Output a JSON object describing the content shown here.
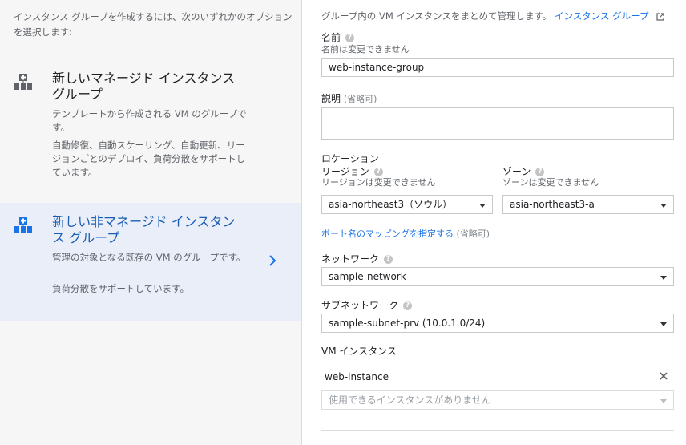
{
  "left": {
    "intro": "インスタンス グループを作成するには、次のいずれかのオプションを選択します:",
    "managed": {
      "title": "新しいマネージド インスタンス グループ",
      "desc1": "テンプレートから作成される VM のグループです。",
      "desc2": "自動修復、自動スケーリング、自動更新、リージョンごとのデプロイ、負荷分散をサポートしています。"
    },
    "unmanaged": {
      "title": "新しい非マネージド インスタンス グループ",
      "desc1": "管理の対象となる既存の VM のグループです。",
      "desc2": "負荷分散をサポートしています。"
    }
  },
  "form": {
    "header_text": "グループ内の VM インスタンスをまとめて管理します。",
    "header_link": "インスタンス グループ",
    "name_label": "名前",
    "name_sub": "名前は変更できません",
    "name_value": "web-instance-group",
    "desc_label": "説明",
    "optional": "(省略可)",
    "location_label": "ロケーション",
    "region_label": "リージョン",
    "region_sub": "リージョンは変更できません",
    "region_value": "asia-northeast3（ソウル）",
    "zone_label": "ゾーン",
    "zone_sub": "ゾーンは変更できません",
    "zone_value": "asia-northeast3-a",
    "port_link": "ポート名のマッピングを指定する",
    "network_label": "ネットワーク",
    "network_value": "sample-network",
    "subnet_label": "サブネットワーク",
    "subnet_value": "sample-subnet-prv (10.0.1.0/24)",
    "vm_label": "VM インスタンス",
    "vm_item": "web-instance",
    "vm_select_placeholder": "使用できるインスタンスがありません",
    "help_glyph": "?"
  },
  "colors": {
    "accent": "#1a73e8",
    "selected_bg": "#e9eef8"
  }
}
